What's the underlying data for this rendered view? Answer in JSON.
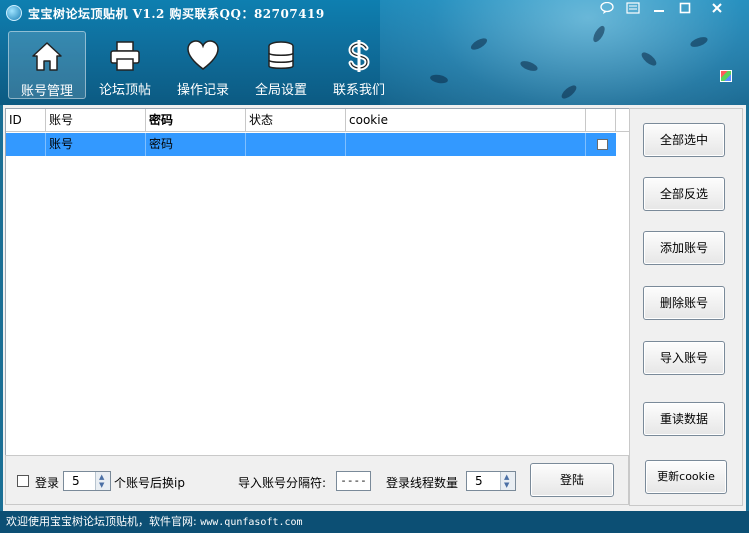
{
  "window": {
    "title": "宝宝树论坛顶贴机 V1.2 购买联系QQ：82707419"
  },
  "nav": [
    {
      "label": "账号管理",
      "icon": "home-icon"
    },
    {
      "label": "论坛顶帖",
      "icon": "printer-icon"
    },
    {
      "label": "操作记录",
      "icon": "heart-icon"
    },
    {
      "label": "全局设置",
      "icon": "database-icon"
    },
    {
      "label": "联系我们",
      "icon": "dollar-icon"
    }
  ],
  "table": {
    "columns": [
      "ID",
      "账号",
      "密码",
      "状态",
      "cookie"
    ],
    "rows": [
      {
        "id": "",
        "account": "账号",
        "password": "密码",
        "status": "",
        "cookie": ""
      }
    ]
  },
  "side_buttons": {
    "select_all": "全部选中",
    "invert_select": "全部反选",
    "add_account": "添加账号",
    "delete_account": "删除账号",
    "import_account": "导入账号",
    "reload_data": "重读数据",
    "update_cookie": "更新cookie"
  },
  "bottom": {
    "login_label": "登录",
    "ip_count": "5",
    "ip_suffix": "个账号后换ip",
    "separator_label": "导入账号分隔符:",
    "separator_value": "----",
    "thread_label": "登录线程数量",
    "thread_count": "5",
    "login_button": "登陆"
  },
  "status": {
    "text": "欢迎使用宝宝树论坛顶贴机，软件官网:",
    "url": "www.qunfasoft.com"
  }
}
